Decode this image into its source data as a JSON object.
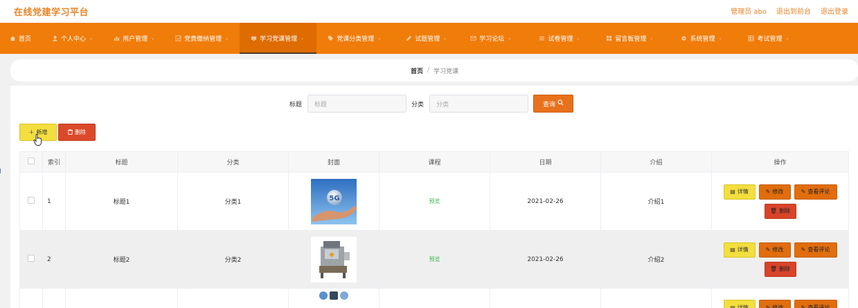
{
  "app": {
    "title": "在线党建学习平台"
  },
  "header": {
    "user_prefix": "管理员",
    "user_name": "abo",
    "to_front": "退出到前台",
    "logout": "退出登录"
  },
  "nav": [
    {
      "label": "首页",
      "icon": "home-icon"
    },
    {
      "label": "个人中心",
      "icon": "user-icon"
    },
    {
      "label": "用户管理",
      "icon": "bar-chart-icon"
    },
    {
      "label": "党费缴纳管理",
      "icon": "form-icon"
    },
    {
      "label": "学习党课管理",
      "icon": "screen-icon",
      "active": true
    },
    {
      "label": "党课分类管理",
      "icon": "tag-icon"
    },
    {
      "label": "试题管理",
      "icon": "edit-icon"
    },
    {
      "label": "学习论坛",
      "icon": "mail-icon"
    },
    {
      "label": "试卷管理",
      "icon": "list-icon"
    },
    {
      "label": "留言板管理",
      "icon": "grid-icon"
    },
    {
      "label": "系统管理",
      "icon": "gear-icon"
    },
    {
      "label": "考试管理",
      "icon": "table-icon"
    }
  ],
  "breadcrumb": {
    "home": "首页",
    "separator": "/",
    "current": "学习党课"
  },
  "search": {
    "title_label": "标题",
    "title_placeholder": "标题",
    "category_label": "分类",
    "category_placeholder": "分类",
    "query_button": "查询"
  },
  "toolbar": {
    "add_label": "新增",
    "delete_label": "删除"
  },
  "table": {
    "columns": [
      "",
      "索引",
      "标题",
      "分类",
      "封面",
      "课程",
      "日期",
      "介绍",
      "操作"
    ],
    "rows": [
      {
        "index": "1",
        "title": "标题1",
        "category": "分类1",
        "cover": "5g-hand-image",
        "course": "预览",
        "date": "2021-02-26",
        "intro": "介绍1"
      },
      {
        "index": "2",
        "title": "标题2",
        "category": "分类2",
        "cover": "machine-image",
        "course": "预览",
        "date": "2021-02-26",
        "intro": "介绍2"
      },
      {
        "index": "",
        "title": "",
        "category": "",
        "cover": "icons-image",
        "course": "",
        "date": "",
        "intro": ""
      }
    ],
    "row_actions": {
      "detail": "详情",
      "edit": "修改",
      "comment": "查看评论",
      "delete": "删除"
    }
  },
  "colors": {
    "brand": "#e7852b",
    "nav_bg": "#f07c0a",
    "nav_active": "#de6c00",
    "add": "#f3de3f",
    "danger": "#da4a2a",
    "preview": "#3bb64b"
  }
}
